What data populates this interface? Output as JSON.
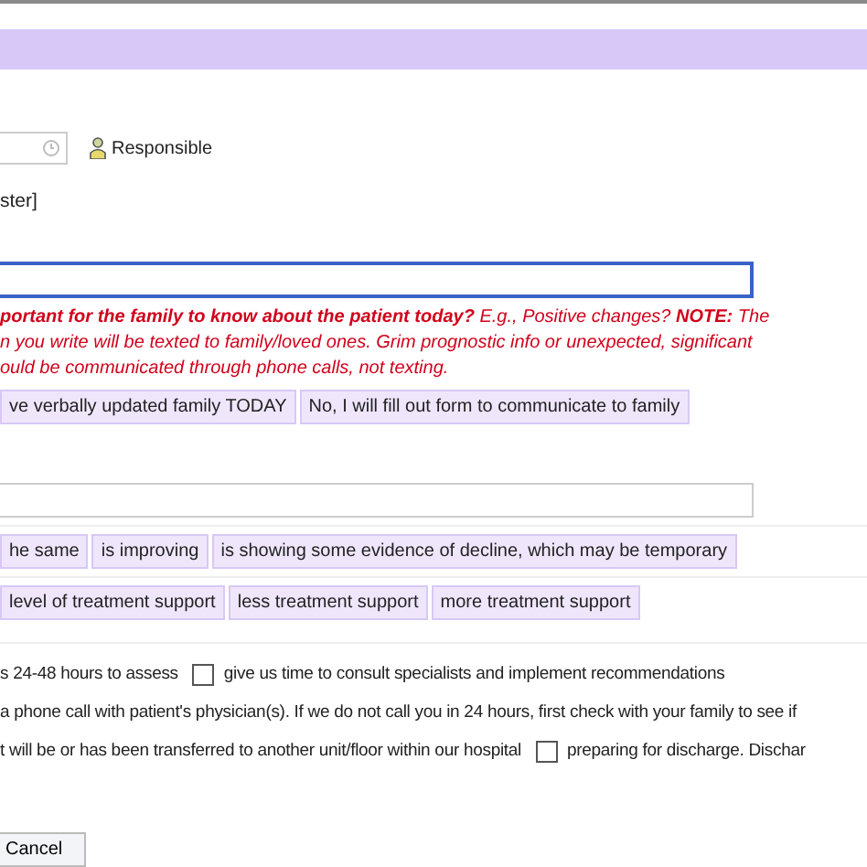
{
  "responsible": {
    "label": "Responsible"
  },
  "section_label": "ster]",
  "instructions": "**portant for the family to know about the patient today?** E.g., Positive changes? **NOTE:** The\nn you write will be texted to family/loved ones. Grim prognostic info or unexpected, significant\nould be communicated through phone calls, not texting.",
  "update_options": [
    {
      "label": "ve verbally updated family TODAY",
      "selected": false
    },
    {
      "label": "No, I will fill out form to communicate to family",
      "selected": false
    }
  ],
  "status_options": [
    {
      "label": "he same",
      "selected": false
    },
    {
      "label": "is improving",
      "selected": false
    },
    {
      "label": "is showing some evidence of decline, which may be temporary",
      "selected": false
    }
  ],
  "support_options": [
    {
      "label": "level of treatment support",
      "selected": false
    },
    {
      "label": "less treatment support",
      "selected": false
    },
    {
      "label": "more treatment support",
      "selected": false
    }
  ],
  "check_lines": [
    [
      {
        "kind": "text",
        "text": "s 24-48 hours to assess"
      },
      {
        "kind": "checkbox",
        "checked": false,
        "text": "give us time to consult specialists and implement recommendations"
      }
    ],
    [
      {
        "kind": "text",
        "text": "a phone call with patient's physician(s). If we do not call you in 24 hours, first check with your family to see if"
      }
    ],
    [
      {
        "kind": "text",
        "text": "t will be or has been transferred to another unit/floor within our hospital"
      },
      {
        "kind": "checkbox",
        "checked": false,
        "text": "preparing for discharge. Dischar"
      }
    ]
  ],
  "cancel_button": "Cancel"
}
